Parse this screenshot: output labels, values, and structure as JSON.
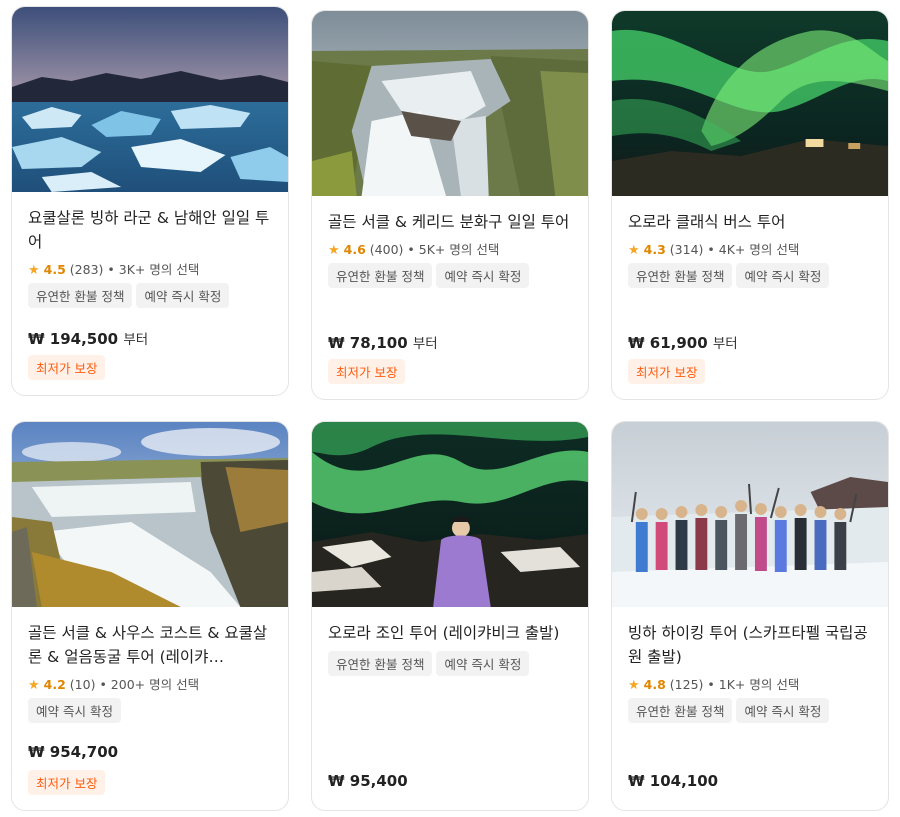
{
  "cards": [
    {
      "title": "요쿨살론 빙하 라군 & 남해안 일일 투어",
      "star": "★",
      "score": "4.5",
      "reviews": "(283)",
      "bullet": "•",
      "chosen": "3K+ 명의 선택",
      "tags": [
        "유연한 환불 정책",
        "예약 즉시 확정"
      ],
      "price": "₩ 194,500",
      "price_suffix": "부터",
      "badge": "최저가 보장",
      "image": "glacier-lagoon-photo"
    },
    {
      "title": "골든 서클 & 케리드 분화구 일일 투어",
      "star": "★",
      "score": "4.6",
      "reviews": "(400)",
      "bullet": "•",
      "chosen": "5K+ 명의 선택",
      "tags": [
        "유연한 환불 정책",
        "예약 즉시 확정"
      ],
      "price": "₩ 78,100",
      "price_suffix": "부터",
      "badge": "최저가 보장",
      "image": "waterfall-photo"
    },
    {
      "title": "오로라 클래식 버스 투어",
      "star": "★",
      "score": "4.3",
      "reviews": "(314)",
      "bullet": "•",
      "chosen": "4K+ 명의 선택",
      "tags": [
        "유연한 환불 정책",
        "예약 즉시 확정"
      ],
      "price": "₩ 61,900",
      "price_suffix": "부터",
      "badge": "최저가 보장",
      "image": "aurora-photo"
    },
    {
      "title": "골든 서클 & 사우스 코스트 & 요쿨살론 & 얼음동굴 투어 (레이캬…",
      "star": "★",
      "score": "4.2",
      "reviews": "(10)",
      "bullet": "•",
      "chosen": "200+ 명의 선택",
      "tags": [
        "예약 즉시 확정"
      ],
      "price": "₩ 954,700",
      "price_suffix": "",
      "badge": "최저가 보장",
      "image": "gullfoss-photo"
    },
    {
      "title": "오로라 조인 투어 (레이캬비크 출발)",
      "tags": [
        "유연한 환불 정책",
        "예약 즉시 확정"
      ],
      "price": "₩ 95,400",
      "price_suffix": "",
      "image": "aurora-person-photo"
    },
    {
      "title": "빙하 하이킹 투어 (스카프타펠 국립공원 출발)",
      "star": "★",
      "score": "4.8",
      "reviews": "(125)",
      "bullet": "•",
      "chosen": "1K+ 명의 선택",
      "tags": [
        "유연한 환불 정책",
        "예약 즉시 확정"
      ],
      "price": "₩ 104,100",
      "price_suffix": "",
      "image": "glacier-hike-photo"
    }
  ]
}
